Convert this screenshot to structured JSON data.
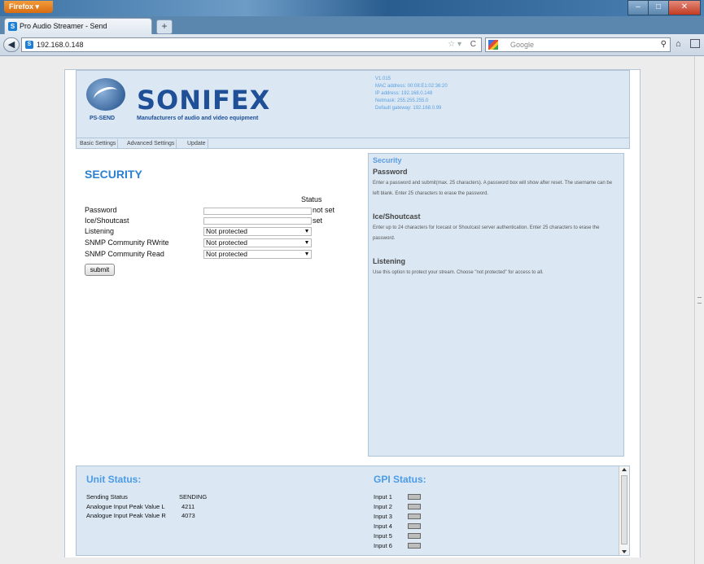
{
  "browser": {
    "menu_label": "Firefox",
    "menu_arrow": "▾",
    "tab_title": "Pro Audio Streamer - Send",
    "tab_favicon": "S",
    "new_tab": "+",
    "url": "192.168.0.148",
    "search_placeholder": "Google",
    "window_controls": {
      "minimize": "–",
      "maximize": "□",
      "close": "✕"
    },
    "icons": {
      "back": "back-arrow-icon",
      "bookmark_star": "star-icon",
      "reload": "reload-icon",
      "search": "search-icon",
      "home": "home-icon",
      "bookmarks": "bookmarks-icon"
    }
  },
  "header": {
    "brand": "SONIFEX",
    "model": "PS-SEND",
    "tagline": "Manufacturers of audio and video equipment",
    "unit_info": [
      "V1.015",
      "MAC address: 00:08:E1:02:36:20",
      "IP address: 192.168.0.148",
      "Netmask: 255.255.255.0",
      "Default gateway: 192.168.0.99"
    ],
    "nav_tabs": [
      "Basic Settings",
      "Advanced Settings",
      "Update"
    ]
  },
  "security": {
    "title": "SECURITY",
    "status_header": "Status",
    "fields": [
      {
        "label": "Password",
        "type": "password",
        "value": "",
        "status": "not set"
      },
      {
        "label": "Ice/Shoutcast",
        "type": "password",
        "value": "",
        "status": "set"
      },
      {
        "label": "Listening",
        "type": "select",
        "value": "Not protected",
        "status": ""
      },
      {
        "label": "SNMP Community RWrite",
        "type": "select",
        "value": "Not protected",
        "status": ""
      },
      {
        "label": "SNMP Community Read",
        "type": "select",
        "value": "Not protected",
        "status": ""
      }
    ],
    "submit_label": "submit"
  },
  "help": {
    "title": "Security",
    "sections": [
      {
        "heading": "Password",
        "text": "Enter a password and submit(max. 25 characters). A password box will show after reset. The username can be left blank. Enter 25 characters to erase the password."
      },
      {
        "heading": "Ice/Shoutcast",
        "text": "Enter up to 24 characters for Icecast or Shoutcast server authentication. Enter 25 characters to erase the password."
      },
      {
        "heading": "Listening",
        "text": "Use this option to protect your stream. Choose \"not protected\" for access to all."
      }
    ]
  },
  "unit_status": {
    "title": "Unit Status:",
    "rows": [
      {
        "label": "Sending Status",
        "value": "SENDING"
      },
      {
        "label": "Analogue Input Peak Value L",
        "value": "4211"
      },
      {
        "label": "Analogue Input Peak Value R",
        "value": "4073"
      }
    ]
  },
  "gpi_status": {
    "title": "GPI Status:",
    "inputs": [
      "Input 1",
      "Input 2",
      "Input 3",
      "Input 4",
      "Input 5",
      "Input 6"
    ],
    "led_color": "#bdbdbd"
  },
  "colors": {
    "accent": "#2d80d0",
    "panel": "#dbe8f4",
    "brand": "#1e4f97"
  }
}
